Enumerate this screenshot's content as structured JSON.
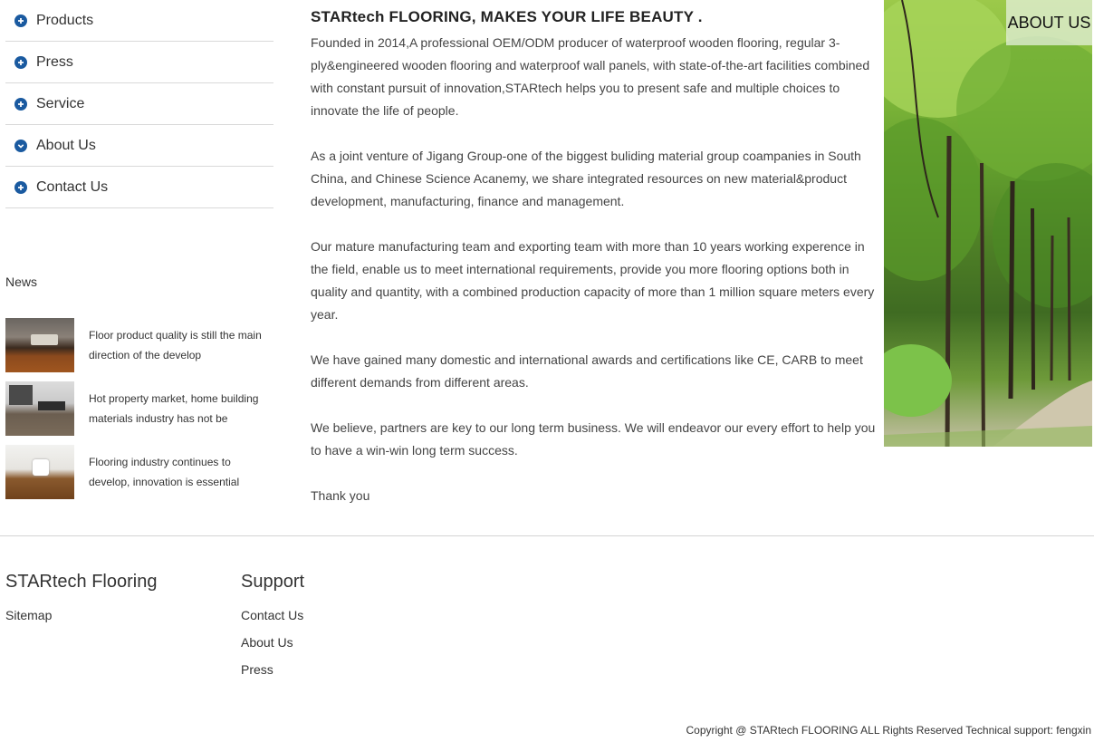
{
  "sidebar": {
    "items": [
      {
        "label": "Products",
        "icon": "plus-circle-icon"
      },
      {
        "label": "Press",
        "icon": "plus-circle-icon"
      },
      {
        "label": "Service",
        "icon": "plus-circle-icon"
      },
      {
        "label": "About Us",
        "icon": "chevron-down-circle-icon"
      },
      {
        "label": "Contact Us",
        "icon": "plus-circle-icon"
      }
    ],
    "accent_color": "#1a5aa0"
  },
  "news": {
    "title": "News",
    "items": [
      {
        "text": "Floor product quality is still the main direction of the develop"
      },
      {
        "text": "Hot property market, home building materials industry has not be"
      },
      {
        "text": "Flooring industry continues to develop, innovation is essential"
      }
    ]
  },
  "main": {
    "title": "STARtech FLOORING, MAKES YOUR LIFE BEAUTY .",
    "paragraphs": [
      "Founded in 2014,A professional OEM/ODM producer of waterproof wooden flooring, regular 3-ply&engineered wooden flooring and waterproof wall panels, with state-of-the-art facilities combined with constant pursuit of innovation,STARtech helps you to present safe and multiple choices to innovate the life of people.",
      "As a joint venture of Jigang Group-one of the biggest buliding material group coampanies in South China, and Chinese Science Acanemy, we share integrated resources on new material&product development, manufacturing, finance and management.",
      "Our mature manufacturing team and exporting team with more than 10 years working experence in the field, enable us to meet international requirements, provide you more flooring options both in quality and quantity, with a combined production capacity of more than 1 million square meters every year.",
      "We have gained many domestic and international awards and certifications like CE, CARB to meet different demands from different areas.",
      "We believe, partners are key to our long term business. We will endeavor our every effort to help you to have a win-win long term success.",
      "Thank you"
    ]
  },
  "about_banner": {
    "label": "ABOUT US"
  },
  "footer": {
    "col1": {
      "title": "STARtech Flooring",
      "links": [
        "Sitemap"
      ]
    },
    "col2": {
      "title": "Support",
      "links": [
        "Contact Us",
        "About Us",
        "Press"
      ]
    },
    "copyright": "Copyright @ STARtech FLOORING ALL Rights Reserved Technical support: fengxin"
  }
}
